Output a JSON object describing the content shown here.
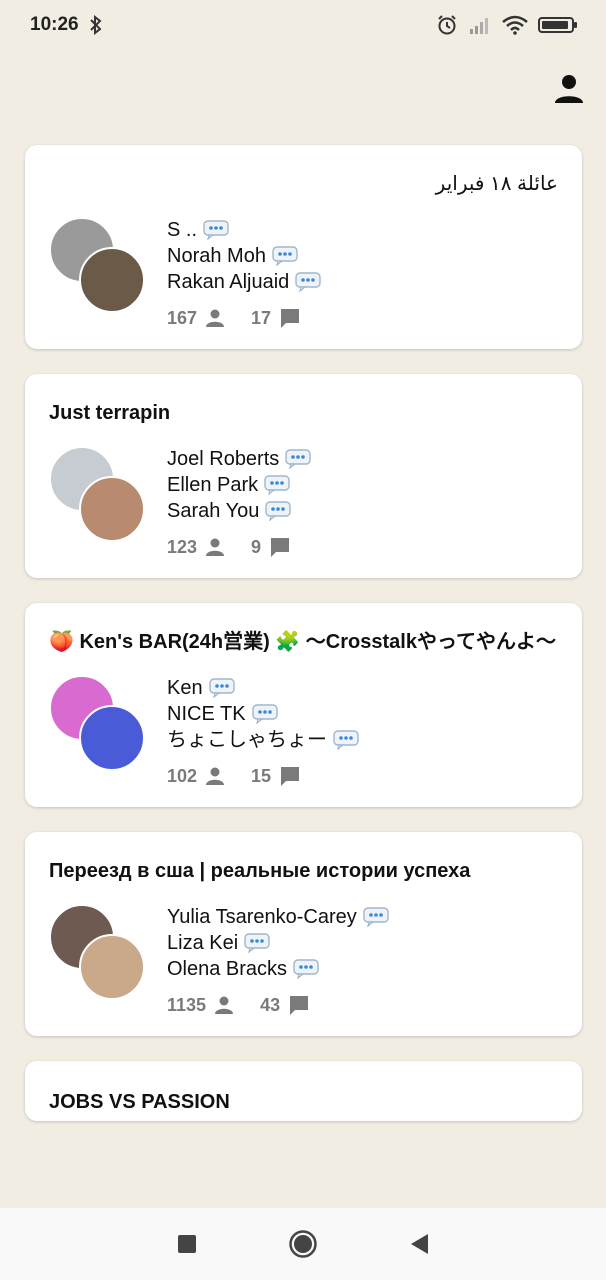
{
  "status": {
    "time": "10:26"
  },
  "groups": [
    {
      "title": "عائلة ١٨ فبراير",
      "rtl": true,
      "members": [
        "S ..",
        "Norah Moh",
        "Rakan Aljuaid"
      ],
      "member_count": "167",
      "message_count": "17",
      "avatar_colors": [
        "#9a9a9a",
        "#6b5a48"
      ]
    },
    {
      "title": "Just terrapin",
      "rtl": false,
      "members": [
        "Joel Roberts",
        "Ellen Park",
        "Sarah You"
      ],
      "member_count": "123",
      "message_count": "9",
      "avatar_colors": [
        "#c7ccd2",
        "#b88a70"
      ]
    },
    {
      "title": "🍑 Ken's BAR(24h営業) 🧩 〜Crosstalkやってやんよ〜",
      "rtl": false,
      "members": [
        "Ken",
        "NICE TK",
        "ちょこしゃちょー"
      ],
      "member_count": "102",
      "message_count": "15",
      "avatar_colors": [
        "#d86ad0",
        "#4a5bd8"
      ]
    },
    {
      "title": "Переезд в сша | реальные истории успеха",
      "rtl": false,
      "members": [
        "Yulia Tsarenko-Carey",
        "Liza Kei",
        "Olena Bracks"
      ],
      "member_count": "1135",
      "message_count": "43",
      "avatar_colors": [
        "#6e5a50",
        "#c9a989"
      ]
    }
  ],
  "partial_card": {
    "title": "JOBS VS PASSION"
  }
}
